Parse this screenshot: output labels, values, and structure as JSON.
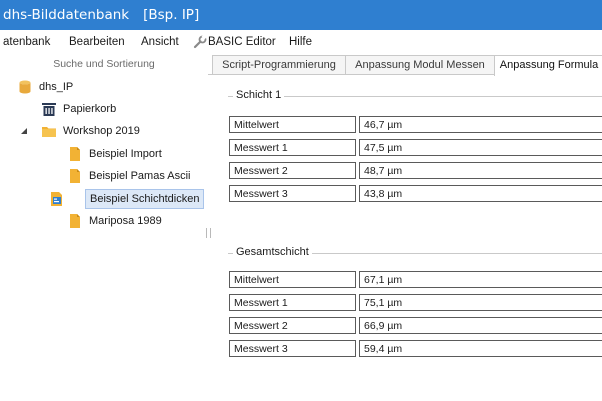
{
  "window": {
    "app_title": "dhs-Bilddatenbank",
    "context": "[Bsp. IP]"
  },
  "menu": {
    "items": [
      "atenbank",
      "Bearbeiten",
      "Ansicht",
      "BASIC Editor",
      "Hilfe"
    ]
  },
  "sidebar": {
    "header": "Suche und Sortierung",
    "tree": [
      {
        "label": "dhs_IP",
        "icon": "database-icon"
      },
      {
        "label": "Papierkorb",
        "icon": "trash-icon"
      },
      {
        "label": "Workshop 2019",
        "icon": "folder-icon"
      },
      {
        "label": "Beispiel Import",
        "icon": "document-icon"
      },
      {
        "label": "Beispiel Pamas Ascii",
        "icon": "document-icon"
      },
      {
        "label": "Beispiel Schichtdicken",
        "icon": "form-document-icon",
        "selected": true
      },
      {
        "label": "Mariposa 1989",
        "icon": "document-icon"
      }
    ]
  },
  "tabs": [
    "Script-Programmierung",
    "Anpassung Modul Messen",
    "Anpassung Formula"
  ],
  "groups": [
    {
      "title": "Schicht 1",
      "rows": [
        {
          "label": "Mittelwert",
          "value": "46,7 µm"
        },
        {
          "label": "Messwert 1",
          "value": "47,5 µm"
        },
        {
          "label": "Messwert 2",
          "value": "48,7 µm"
        },
        {
          "label": "Messwert 3",
          "value": "43,8 µm"
        }
      ]
    },
    {
      "title": "Gesamtschicht",
      "rows": [
        {
          "label": "Mittelwert",
          "value": "67,1 µm"
        },
        {
          "label": "Messwert 1",
          "value": "75,1 µm"
        },
        {
          "label": "Messwert 2",
          "value": "66,9 µm"
        },
        {
          "label": "Messwert 3",
          "value": "59,4 µm"
        }
      ]
    }
  ],
  "colors": {
    "titlebar": "#2f7fd0",
    "selection": "#dce8f7",
    "folder": "#f2b234",
    "database": "#e8a93c"
  }
}
